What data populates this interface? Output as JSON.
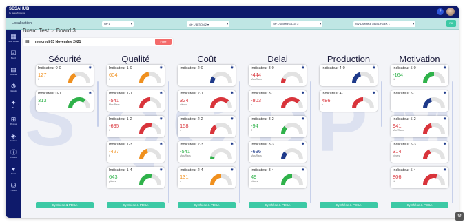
{
  "app": {
    "logo_main": "SESAHUB",
    "logo_sub": "by Sesa Systems",
    "notif_count": "2"
  },
  "filters": {
    "location_label": "Localisation",
    "selects": [
      "Niv 1",
      "Niv 1/BETON 2 ▾",
      "Niv 1/Secteur 1/LG5 2",
      "Niv 1/Secteur 1/Bd 1/HGEX 1"
    ],
    "filter_button": "Filt"
  },
  "sidebar": [
    "Sesa Hubble",
    "Board",
    "Agenda",
    "Opératio",
    "5S",
    "Process",
    "Analyse",
    "Indicatio",
    "Favori",
    "Tâches"
  ],
  "breadcrumb": {
    "part1": "Board Test",
    "sep": ">",
    "part2": "Board 3"
  },
  "date": {
    "text": "mercredi 03 Novembre 2021",
    "button": "Filtre"
  },
  "watermark": "S Q C D P M",
  "columns": [
    {
      "title": "Sécurité",
      "sync": "Synthèse & PDCA",
      "cards": [
        {
          "name": "Indicateur 0-0",
          "value": "127",
          "unit": "h",
          "color": "#f0901e",
          "level": 0.35
        },
        {
          "name": "Indicateur 0-1",
          "value": "313",
          "unit": "h",
          "color": "#2fb24a",
          "level": 0.7
        }
      ]
    },
    {
      "title": "Qualité",
      "sync": "Synthèse & PDCA",
      "cards": [
        {
          "name": "Indicateur 1-0",
          "value": "604",
          "unit": "h",
          "color": "#f0901e",
          "level": 0.45
        },
        {
          "name": "Indicateur 1-1",
          "value": "-541",
          "unit": "Max/Raus",
          "color": "#d9343b",
          "level": 0.5
        },
        {
          "name": "Indicateur 1-2",
          "value": "-695",
          "unit": "h",
          "color": "#d9343b",
          "level": 0.55
        },
        {
          "name": "Indicateur 1-3",
          "value": "-427",
          "unit": "h",
          "color": "#f0901e",
          "level": 0.4
        },
        {
          "name": "Indicateur 1-4",
          "value": "643",
          "unit": "pièces",
          "color": "#2fb24a",
          "level": 0.55
        }
      ]
    },
    {
      "title": "Coût",
      "sync": "Synthèse & PDCA",
      "cards": [
        {
          "name": "Indicateur 2-0",
          "value": "",
          "unit": "",
          "color": "#1e3a8a",
          "level": 0.2
        },
        {
          "name": "Indicateur 2-1",
          "value": "324",
          "unit": "pièces",
          "color": "#d9343b",
          "level": 0.75
        },
        {
          "name": "Indicateur 2-2",
          "value": "158",
          "unit": "h",
          "color": "#d9343b",
          "level": 0.3
        },
        {
          "name": "Indicateur 2-3",
          "value": "-541",
          "unit": "Max/Raus",
          "color": "#2fb24a",
          "level": 0.1
        },
        {
          "name": "Indicateur 2-4",
          "value": "131",
          "unit": "h",
          "color": "#f0901e",
          "level": 0.5
        }
      ]
    },
    {
      "title": "Delai",
      "sync": "Synthèse & PDCA",
      "cards": [
        {
          "name": "Indicateur 3-0",
          "value": "-444",
          "unit": "Max/Raus",
          "color": "#d9343b",
          "level": 0.15
        },
        {
          "name": "Indicateur 3-1",
          "value": "-803",
          "unit": "h",
          "color": "#d9343b",
          "level": 0.75
        },
        {
          "name": "Indicateur 3-2",
          "value": "-94",
          "unit": "€",
          "color": "#2fb24a",
          "level": 0.25
        },
        {
          "name": "Indicateur 3-3",
          "value": "-696",
          "unit": "Max/Raus",
          "color": "#1e3a8a",
          "level": 0.25
        },
        {
          "name": "Indicateur 3-4",
          "value": "49",
          "unit": "pièces",
          "color": "#2fb24a",
          "level": 0.5
        }
      ]
    },
    {
      "title": "Production",
      "sync": "Synthèse & PDCA",
      "cards": [
        {
          "name": "Indicateur 4-0",
          "value": "",
          "unit": "",
          "color": "#1e3a8a",
          "level": 0.4
        },
        {
          "name": "Indicateur 4-1",
          "value": "486",
          "unit": "h",
          "color": "#d9343b",
          "level": 0.5
        }
      ]
    },
    {
      "title": "Motivation",
      "sync": "Synthèse & PDCA",
      "cards": [
        {
          "name": "Indicateur 5-0",
          "value": "-164",
          "unit": "%",
          "color": "#2fb24a",
          "level": 0.5
        },
        {
          "name": "Indicateur 5-1",
          "value": "",
          "unit": "",
          "color": "#1e3a8a",
          "level": 0.4
        },
        {
          "name": "Indicateur 5-2",
          "value": "941",
          "unit": "Max/Raus",
          "color": "#d9343b",
          "level": 0.4
        },
        {
          "name": "Indicateur 5-3",
          "value": "314",
          "unit": "pièces",
          "color": "#d9343b",
          "level": 0.35
        },
        {
          "name": "Indicateur 5-4",
          "value": "806",
          "unit": "%",
          "color": "#d9343b",
          "level": 0.6
        }
      ]
    }
  ]
}
